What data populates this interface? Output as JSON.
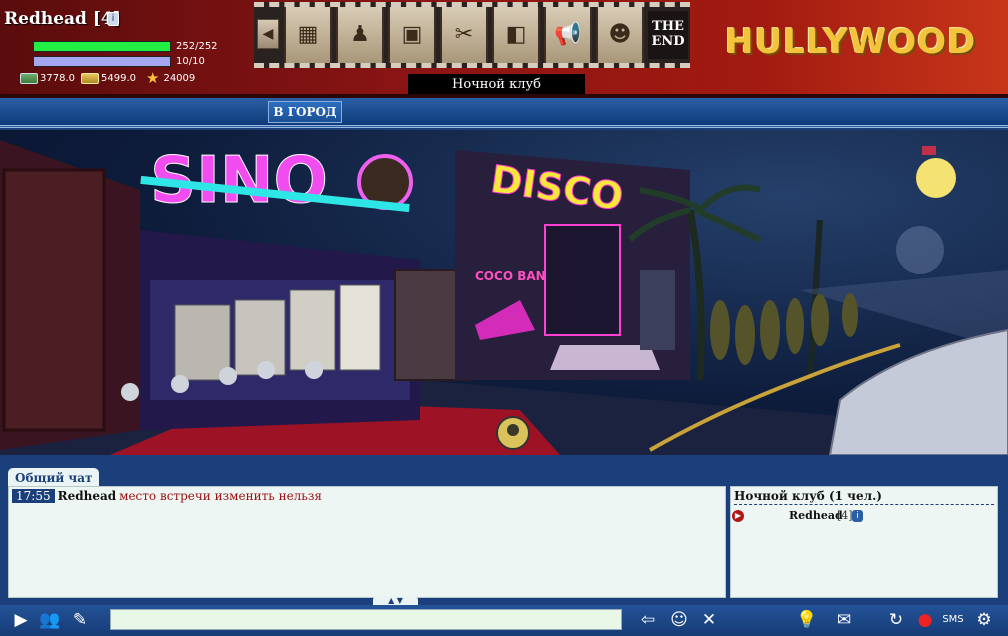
{
  "player": {
    "name": "Redhead [4]",
    "hp": {
      "text": "252/252",
      "fraction": 1.0
    },
    "energy": {
      "text": "10/10",
      "fraction": 1.0
    },
    "money": "3778.0",
    "gold": "5499.0",
    "rating": "24009"
  },
  "header": {
    "film_end_label": "THE END",
    "location": "Ночной клуб",
    "logo_text": "HULLYWOOD"
  },
  "nav": {
    "to_city": "В ГОРОД"
  },
  "scene": {
    "signs": {
      "casino": "SINO",
      "disco": "DISCO",
      "coco": "COCO BANGO"
    }
  },
  "chat": {
    "tab_label": "Общий чат",
    "messages": [
      {
        "time": "17:55",
        "user": "Redhead",
        "text": "место встречи изменить нельзя"
      }
    ],
    "input_value": ""
  },
  "room": {
    "title": "Ночной клуб (1 чел.)",
    "users": [
      {
        "name": "Redhead",
        "level": "[4]"
      }
    ]
  },
  "toolbar": {
    "sms_label": "SMS"
  },
  "colors": {
    "header_red": "#8a1414",
    "ui_blue": "#1b3f7a",
    "hp_green": "#22ee44",
    "energy_violet": "#a6a6f0",
    "message_red": "#9b1010"
  }
}
